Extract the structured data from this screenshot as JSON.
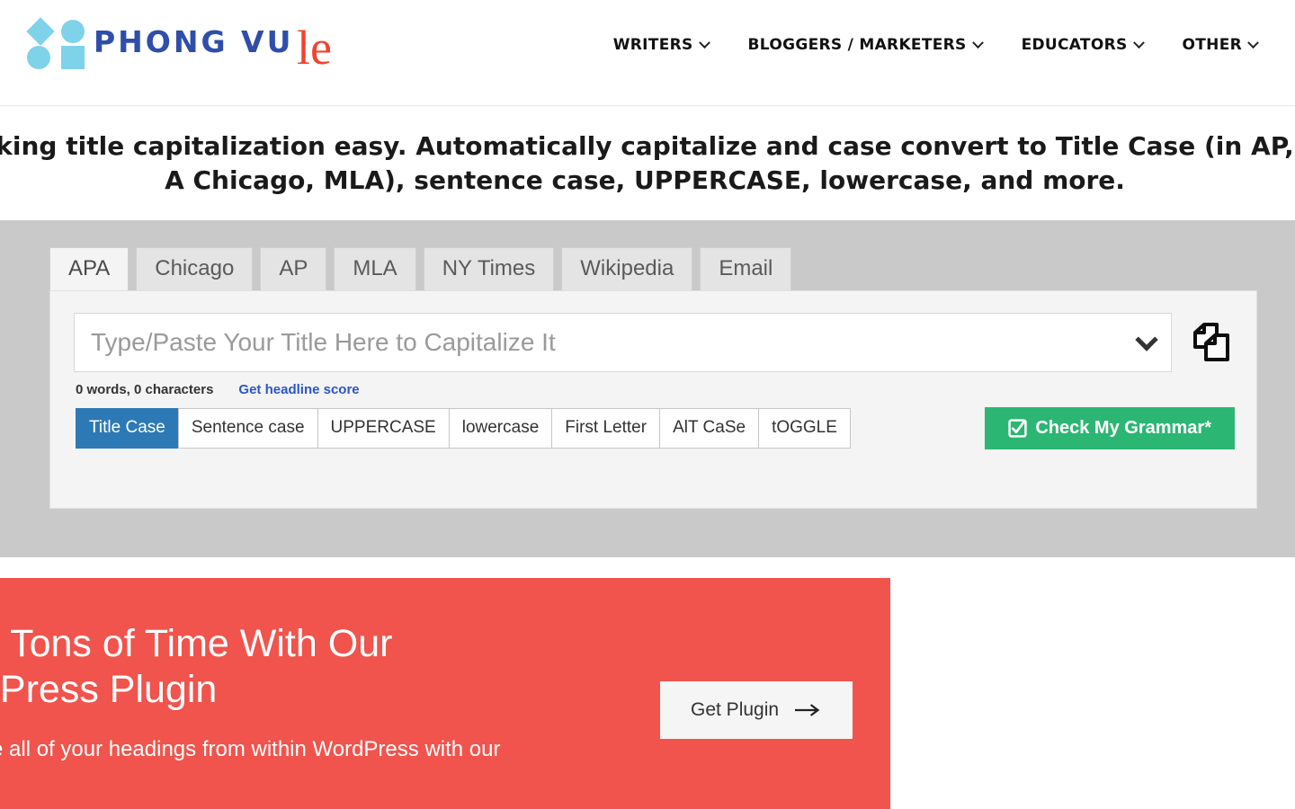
{
  "header": {
    "brand_overlay": {
      "word": "PHONG VU",
      "logo_icon": "four-shapes-logo",
      "color": "#2f4eab",
      "shape_color": "#7ed2ea"
    },
    "site_logo_remnant": "le",
    "site_logo_remnant_color": "#f4422e",
    "nav": [
      {
        "label": "WRITERS",
        "icon": "chevron-down-icon"
      },
      {
        "label": "BLOGGERS / MARKETERS",
        "icon": "chevron-down-icon"
      },
      {
        "label": "EDUCATORS",
        "icon": "chevron-down-icon"
      },
      {
        "label": "OTHER",
        "icon": "chevron-down-icon"
      }
    ]
  },
  "headline": "king title capitalization easy. Automatically capitalize and case convert to Title Case (in AP, A Chicago, MLA), sentence case, UPPERCASE, lowercase, and more.",
  "tool": {
    "tabs": [
      {
        "label": "APA",
        "active": true
      },
      {
        "label": "Chicago",
        "active": false
      },
      {
        "label": "AP",
        "active": false
      },
      {
        "label": "MLA",
        "active": false
      },
      {
        "label": "NY Times",
        "active": false
      },
      {
        "label": "Wikipedia",
        "active": false
      },
      {
        "label": "Email",
        "active": false
      }
    ],
    "input": {
      "value": "",
      "placeholder": "Type/Paste Your Title Here to Capitalize It",
      "caret_icon": "chevron-down-icon",
      "copy_icon": "copy-icon"
    },
    "meta": {
      "count": "0 words, 0 characters",
      "link": "Get headline score",
      "link_color": "#2b56c4"
    },
    "case_buttons": [
      {
        "label": "Title Case",
        "active": true
      },
      {
        "label": "Sentence case",
        "active": false
      },
      {
        "label": "UPPERCASE",
        "active": false
      },
      {
        "label": "lowercase",
        "active": false
      },
      {
        "label": "First Letter",
        "active": false
      },
      {
        "label": "AlT CaSe",
        "active": false
      },
      {
        "label": "tOGGLE",
        "active": false
      }
    ],
    "grammar_button": {
      "label": "Check My Grammar*",
      "icon": "check-square-icon",
      "color": "#2cb673"
    },
    "active_color": "#2d79b5",
    "section_bg": "#c9c9c9"
  },
  "promo": {
    "title_line1": "e Tons of Time With Our",
    "title_line2": "dPress Plugin",
    "subtitle": "ze all of your headings from within WordPress with our",
    "cta_label": "Get Plugin",
    "cta_icon": "arrow-right-icon",
    "bg_color": "#f0544d"
  }
}
